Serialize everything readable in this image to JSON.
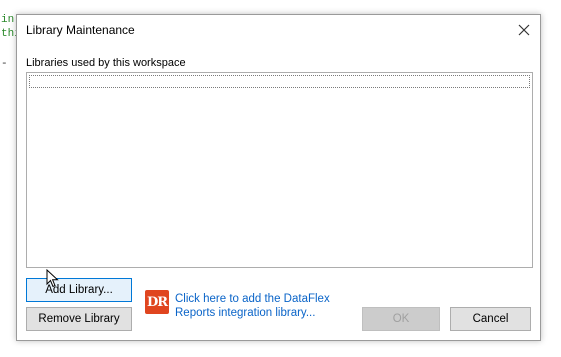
{
  "background_code": {
    "line1": "in",
    "line2": "thi",
    "line3": "-"
  },
  "dialog": {
    "title": "Library Maintenance",
    "group_label": "Libraries used by this workspace",
    "libraries": [],
    "buttons": {
      "add_library": "Add Library...",
      "remove_library": "Remove Library",
      "ok": "OK",
      "cancel": "Cancel"
    },
    "dataflex_link": {
      "line1": "Click here to add the DataFlex",
      "line2": "Reports integration library..."
    },
    "logo_text": "DR",
    "icons": {
      "close": "close-icon",
      "logo": "dataflex-reports-logo-icon",
      "cursor": "mouse-cursor-icon"
    },
    "colors": {
      "link": "#0a64c8",
      "logo_bg": "#e0451f",
      "default_button_border": "#0078d7"
    }
  }
}
